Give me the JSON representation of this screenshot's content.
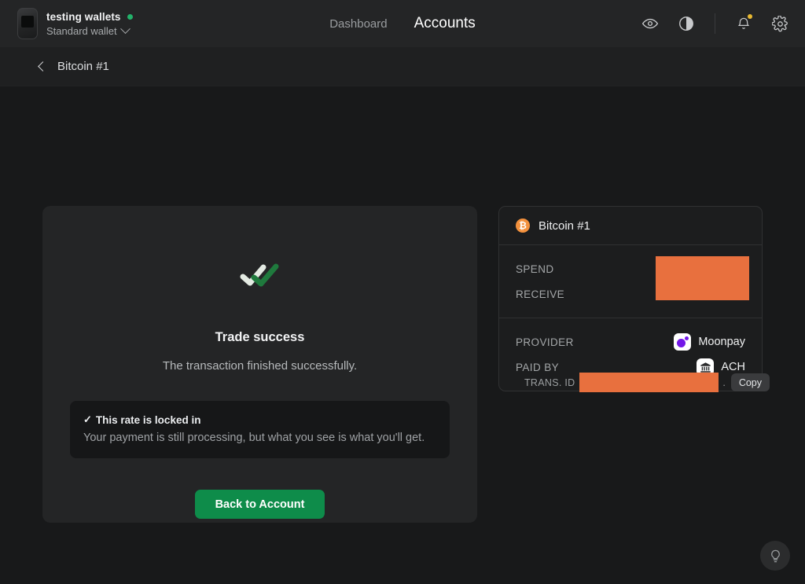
{
  "topbar": {
    "wallet_name": "testing wallets",
    "wallet_type": "Standard wallet",
    "nav": [
      {
        "label": "Dashboard",
        "active": false
      },
      {
        "label": "Accounts",
        "active": true
      }
    ],
    "icons": {
      "eye": "eye-icon",
      "contrast": "contrast-icon",
      "bell": "bell-icon",
      "gear": "gear-icon"
    }
  },
  "breadcrumb": {
    "back": "back-chevron-icon",
    "label": "Bitcoin #1"
  },
  "success": {
    "icon": "double-check-icon",
    "title": "Trade success",
    "subtitle": "The transaction finished successfully.",
    "notice": {
      "check": "✓",
      "title": "This rate is locked in",
      "body": "Your payment is still processing, but what you see is what you'll get."
    },
    "button_label": "Back to Account"
  },
  "summary": {
    "header": {
      "asset_symbol": "₿",
      "asset_label": "Bitcoin #1"
    },
    "rows": [
      {
        "label": "SPEND",
        "value": "",
        "redacted": true
      },
      {
        "label": "RECEIVE",
        "value": "",
        "redacted": true
      },
      {
        "label": "PROVIDER",
        "value": "Moonpay",
        "logo": "moonpay-logo"
      },
      {
        "label": "PAID BY",
        "value": "ACH",
        "logo": "bank-icon"
      }
    ]
  },
  "transaction": {
    "label": "TRANS. ID",
    "value": "",
    "trailing": ".",
    "copy_label": "Copy"
  },
  "help": {
    "icon": "lightbulb-icon"
  },
  "colors": {
    "page_bg": "#18191a",
    "panel_bg": "#242526",
    "card_bg": "#1c1d1e",
    "accent_green": "#0e8c4a",
    "redaction_orange": "#e8703e",
    "bitcoin_orange": "#f3913d",
    "moonpay_purple": "#7317e8",
    "status_green": "#23b26a",
    "badge_yellow": "#e8b931"
  }
}
